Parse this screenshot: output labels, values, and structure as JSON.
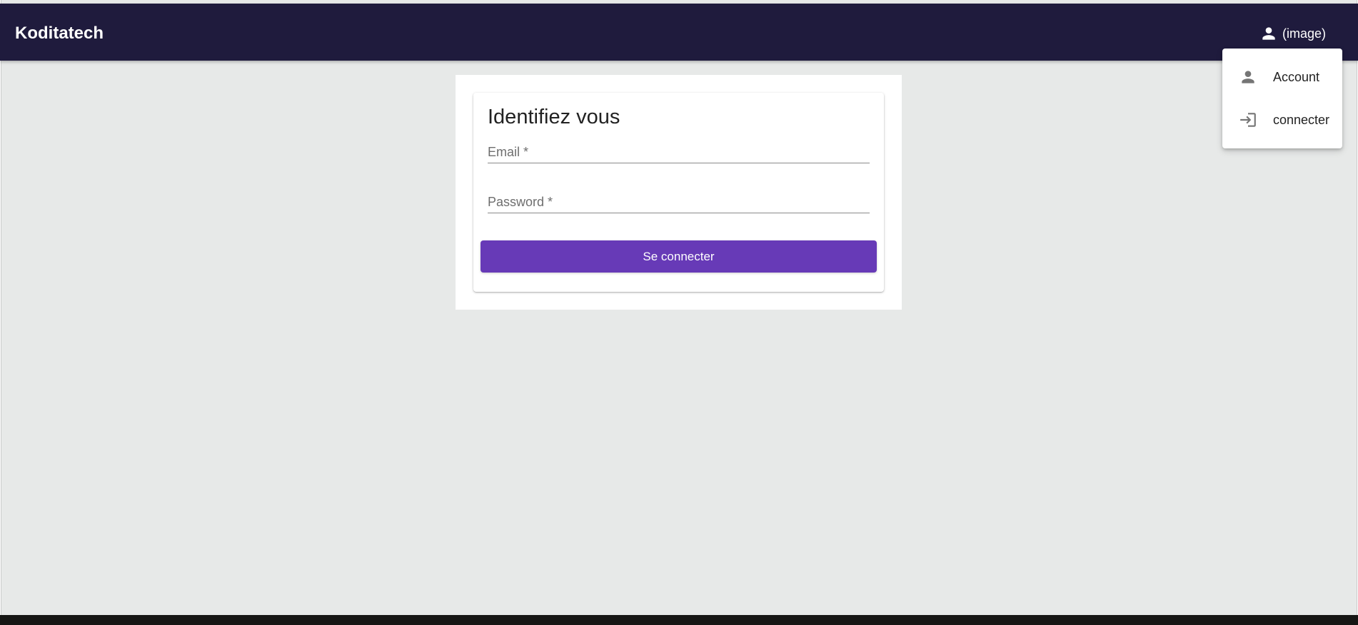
{
  "header": {
    "brand": "Koditatech",
    "user_button": {
      "icon": "person-icon",
      "label": "(image)"
    }
  },
  "login": {
    "title": "Identifiez vous",
    "email": {
      "placeholder": "Email *",
      "value": ""
    },
    "password": {
      "placeholder": "Password *",
      "value": ""
    },
    "submit_label": "Se connecter"
  },
  "user_menu": {
    "items": [
      {
        "icon": "person-icon",
        "label": "Account"
      },
      {
        "icon": "login-icon",
        "label": "connecter"
      }
    ]
  },
  "colors": {
    "toolbar": "#1f1b3d",
    "primary": "#673ab7",
    "background": "#e7e9e8"
  }
}
